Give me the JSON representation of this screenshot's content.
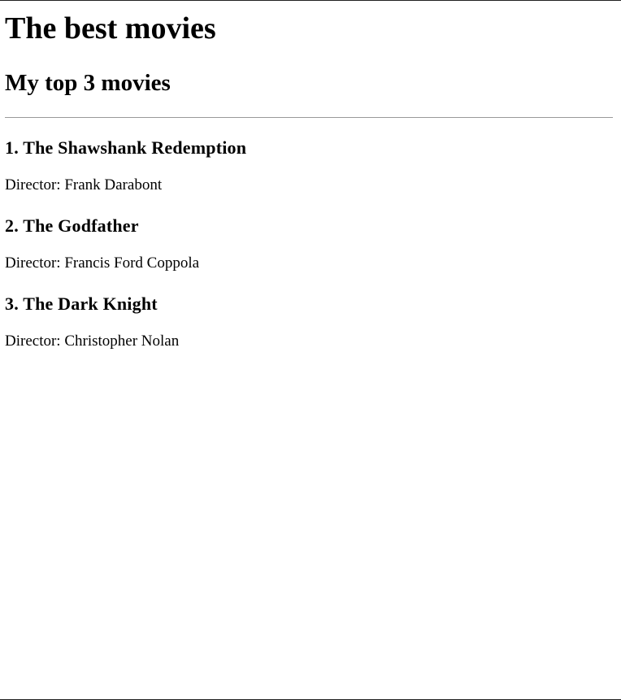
{
  "header": {
    "title": "The best movies",
    "subtitle": "My top 3 movies"
  },
  "movies": [
    {
      "title": "1. The Shawshank Redemption",
      "director": "Director: Frank Darabont"
    },
    {
      "title": "2. The Godfather",
      "director": "Director: Francis Ford Coppola"
    },
    {
      "title": "3. The Dark Knight",
      "director": "Director: Christopher Nolan"
    }
  ]
}
